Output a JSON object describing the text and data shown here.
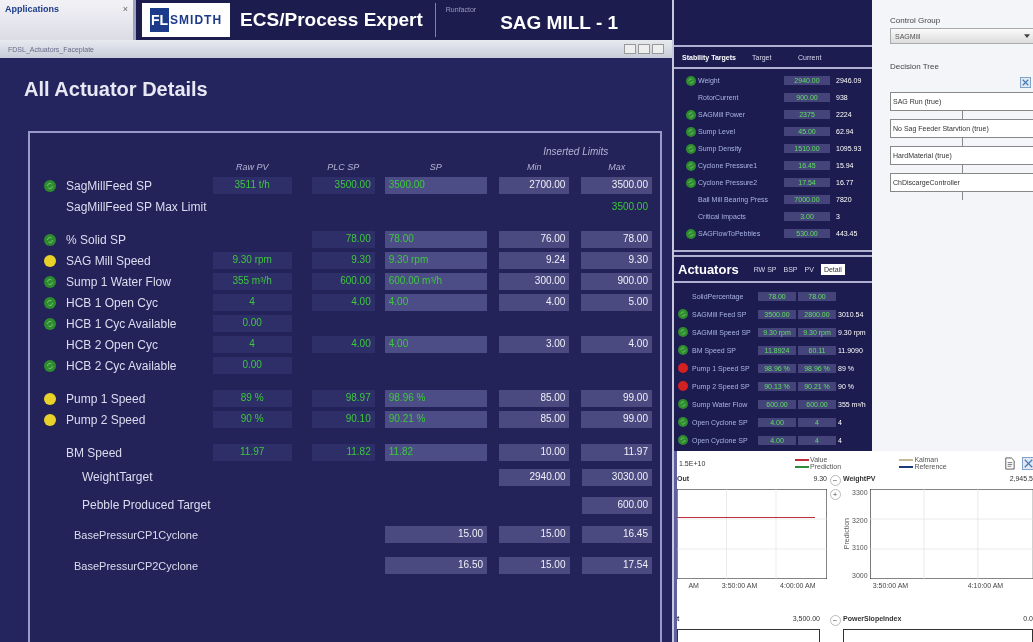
{
  "app_panel": {
    "title": "Applications",
    "close": "×"
  },
  "header": {
    "logo_mark": "FL",
    "logo_text": "SMIDTH",
    "product": "ECS/Process Expert",
    "unit_label": "Runfactor",
    "unit": "SAG MILL - 1"
  },
  "faceplate": {
    "title": "FDSL_Actuators_Faceplate"
  },
  "page_title": "All Actuator Details",
  "table": {
    "group_label": "Inserted Limits",
    "columns": [
      "Raw PV",
      "PLC SP",
      "SP",
      "Min",
      "Max"
    ],
    "groups": [
      {
        "rows": [
          {
            "kind": "actuator",
            "color": "#2e8b2e",
            "label": "SagMillFeed SP",
            "raw_pv": "3511 t/h",
            "plc_sp": "3500.00",
            "sp": "3500.00",
            "min": "2700.00",
            "max": "3500.00"
          },
          {
            "kind": "limit",
            "label": "SagMillFeed SP Max Limit",
            "max": "3500.00"
          }
        ]
      },
      {
        "rows": [
          {
            "kind": "actuator",
            "color": "#2e8b2e",
            "label": "% Solid SP",
            "plc_sp": "78.00",
            "sp": "78.00",
            "min": "76.00",
            "max": "78.00"
          },
          {
            "kind": "actuator",
            "color": "#e8d22a",
            "label": "SAG Mill Speed",
            "raw_pv": "9.30 rpm",
            "plc_sp": "9.30",
            "sp": "9.30 rpm",
            "min": "9.24",
            "max": "9.30"
          },
          {
            "kind": "actuator",
            "color": "#2e8b2e",
            "label": "Sump 1 Water Flow",
            "raw_pv": "355 m³/h",
            "plc_sp": "600.00",
            "sp": "600.00 m³/h",
            "min": "300.00",
            "max": "900.00"
          },
          {
            "kind": "actuator",
            "color": "#2e8b2e",
            "label": "HCB 1 Open Cyc",
            "raw_pv": "4",
            "plc_sp": "4.00",
            "sp": "4.00",
            "min": "4.00",
            "max": "5.00"
          },
          {
            "kind": "actuator",
            "color": "#2e8b2e",
            "label": "HCB 1 Cyc Available",
            "raw_pv": "0.00"
          },
          {
            "kind": "actuator",
            "label": "HCB 2 Open Cyc",
            "raw_pv": "4",
            "plc_sp": "4.00",
            "sp": "4.00",
            "min": "3.00",
            "max": "4.00"
          },
          {
            "kind": "actuator",
            "color": "#2e8b2e",
            "label": "HCB 2 Cyc Available",
            "raw_pv": "0.00"
          }
        ]
      },
      {
        "rows": [
          {
            "kind": "actuator",
            "color": "#e8d22a",
            "label": "Pump 1 Speed",
            "raw_pv": "89 %",
            "plc_sp": "98.97",
            "sp": "98.96 %",
            "min": "85.00",
            "max": "99.00"
          },
          {
            "kind": "actuator",
            "color": "#e8d22a",
            "label": "Pump 2 Speed",
            "raw_pv": "90 %",
            "plc_sp": "90.10",
            "sp": "90.21 %",
            "min": "85.00",
            "max": "99.00"
          }
        ]
      },
      {
        "rows": [
          {
            "kind": "actuator",
            "label": "BM Speed",
            "raw_pv": "11.97",
            "plc_sp": "11.82",
            "sp": "11.82",
            "min": "10.00",
            "max": "11.97"
          },
          {
            "kind": "target",
            "label": "WeightTarget",
            "min": "2940.00",
            "max": "3030.00"
          },
          {
            "kind": "target",
            "label": "Pebble Produced Target",
            "max": "600.00"
          },
          {
            "kind": "pressure",
            "label": "BasePressurCP1Cyclone",
            "sp": "15.00",
            "min": "15.00",
            "max": "16.45"
          },
          {
            "kind": "pressure",
            "label": "BasePressurCP2Cyclone",
            "sp": "16.50",
            "min": "15.00",
            "max": "17.54"
          }
        ]
      }
    ]
  },
  "stability": {
    "title": "Stability Targets",
    "columns": [
      "Target",
      "Current"
    ],
    "rows": [
      {
        "color": "#2e8b2e",
        "name": "Weight",
        "target": "2940.00",
        "current": "2946.09"
      },
      {
        "name": "RotorCurrent",
        "target": "900.00",
        "current": "938"
      },
      {
        "color": "#2e8b2e",
        "name": "SAGMill Power",
        "target": "2375",
        "current": "2224"
      },
      {
        "color": "#2e8b2e",
        "name": "Sump Level",
        "target": "45.00",
        "current": "62.94"
      },
      {
        "color": "#2e8b2e",
        "name": "Sump Density",
        "target": "1510.00",
        "current": "1095.93"
      },
      {
        "color": "#2e8b2e",
        "name": "Cyclone Pressure1",
        "target": "16.45",
        "current": "15.94"
      },
      {
        "color": "#2e8b2e",
        "name": "Cyclone Pressure2",
        "target": "17.54",
        "current": "16.77"
      },
      {
        "name": "Ball Mill Bearing Press",
        "target": "7000.00",
        "current": "7820"
      },
      {
        "name": "Critical Impacts",
        "target": "3.00",
        "current": "3"
      },
      {
        "color": "#2e8b2e",
        "name": "SAGFlowToPebbles",
        "target": "530.00",
        "current": "443.45"
      }
    ]
  },
  "actuators": {
    "title": "Actuators",
    "columns": [
      "RW SP",
      "BSP",
      "PV"
    ],
    "button": "Detail",
    "rows": [
      {
        "name": "SolidPercentage",
        "values": [
          "78.00",
          "78.00"
        ]
      },
      {
        "color": "#2e8b2e",
        "name": "SAGMill Feed SP",
        "values": [
          "3500.00",
          "2800.00",
          "3010.54"
        ]
      },
      {
        "color": "#2e8b2e",
        "name": "SAGMill Speed SP",
        "values": [
          "9.30 rpm",
          "9.30 rpm",
          "9.30 rpm"
        ]
      },
      {
        "color": "#2e8b2e",
        "name": "BM Speed SP",
        "values": [
          "11.8924",
          "60.11",
          "11.9090"
        ]
      },
      {
        "color": "#d42020",
        "name": "Pump 1 Speed SP",
        "values": [
          "98.96 %",
          "98.96 %",
          "89 %"
        ]
      },
      {
        "color": "#d42020",
        "name": "Pump 2 Speed SP",
        "values": [
          "90.13 %",
          "90.21 %",
          "90 %"
        ]
      },
      {
        "color": "#2e8b2e",
        "name": "Sump Water Flow",
        "values": [
          "600.00",
          "600.00",
          "355 m³/h"
        ]
      },
      {
        "color": "#2e8b2e",
        "name": "Open Cyclone SP",
        "values": [
          "4.00",
          "4",
          "4"
        ]
      },
      {
        "color": "#2e8b2e",
        "name": "Open Cyclone SP",
        "values": [
          "4.00",
          "4",
          "4"
        ]
      }
    ]
  },
  "control_group": {
    "label": "Control Group",
    "value": "SAGMill"
  },
  "decision_tree": {
    "label": "Decision Tree",
    "nodes": [
      "SAG Run (true)",
      "No Sag Feeder Starvtion (true)",
      "HardMaterial (true)",
      "ChDiscargeController"
    ]
  },
  "trend": {
    "scale": "1.5E+10",
    "legend": [
      {
        "name": "Value",
        "color": "#c0303a"
      },
      {
        "name": "Kalman",
        "color": "#c8b89a"
      },
      {
        "name": "Prediction",
        "color": "#2e8b3a"
      },
      {
        "name": "Reference",
        "color": "#1e3a78"
      }
    ],
    "panels": [
      {
        "title": "Out",
        "value": "9.30",
        "xticks": [
          "AM",
          "3:50:00 AM",
          "4:00:00 AM"
        ],
        "line": true
      },
      {
        "title": "WeightPV",
        "value": "2,945.5",
        "buttons": [
          "−",
          "+"
        ],
        "xticks": [
          "3:50:00 AM",
          "4:10:00 AM"
        ],
        "yticks": [
          "3300",
          "3200",
          "3100",
          "3000"
        ],
        "ylabel": "Prediction",
        "line": false
      },
      {
        "title": "t",
        "value": "3,500.00"
      },
      {
        "title": "PowerSlopeIndex",
        "value": "0.0",
        "buttons": [
          "−"
        ]
      }
    ]
  }
}
